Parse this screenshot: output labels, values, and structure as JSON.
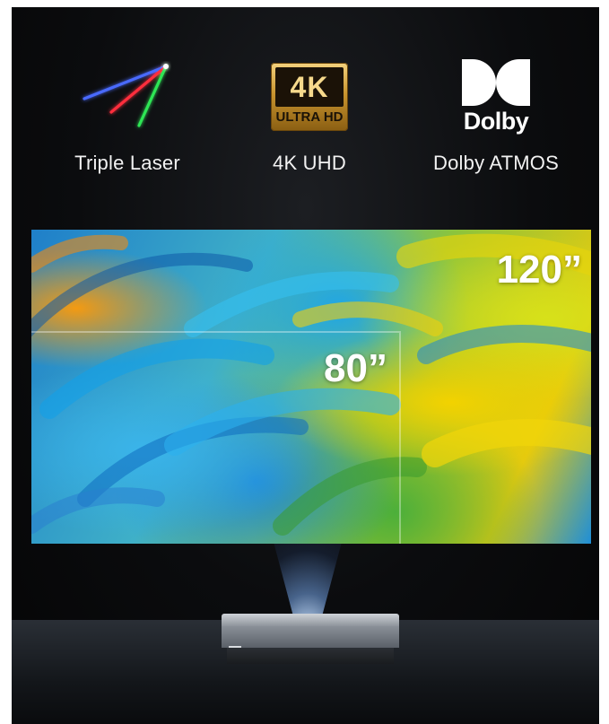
{
  "features": [
    {
      "icon": "laser-icon",
      "label": "Triple Laser"
    },
    {
      "icon": "4k-ultra-hd-badge-icon",
      "label": "4K UHD",
      "badge_main": "4K",
      "badge_sub": "ULTRA HD"
    },
    {
      "icon": "dolby-logo-icon",
      "label": "Dolby ATMOS",
      "logo_word": "Dolby"
    }
  ],
  "screen_sizes": {
    "large": "120”",
    "small": "80”"
  },
  "colors": {
    "background": "#0b0c0e",
    "laser_blue": "#3f5bff",
    "laser_red": "#ff2a2a",
    "laser_green": "#22e04a",
    "gold": "#d7a23c"
  }
}
